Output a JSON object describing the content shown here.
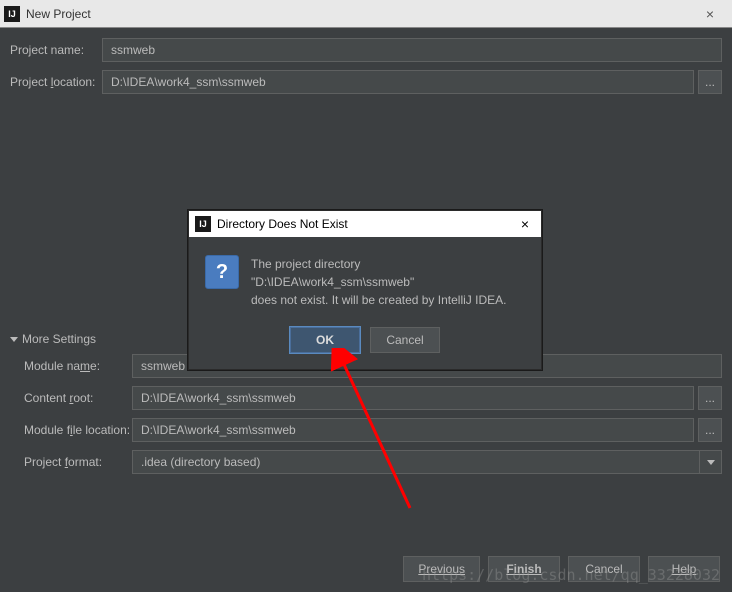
{
  "window": {
    "title": "New Project",
    "close_glyph": "×"
  },
  "fields": {
    "project_name_label": "Project name:",
    "project_name_value": "ssmweb",
    "project_location_label_pre": "Project ",
    "project_location_label_u": "l",
    "project_location_label_post": "ocation:",
    "project_location_value": "D:\\IDEA\\work4_ssm\\ssmweb",
    "browse_glyph": "..."
  },
  "more": {
    "header": "More Settings",
    "module_name_label_pre": "Module na",
    "module_name_label_u": "m",
    "module_name_label_post": "e:",
    "module_name_value": "ssmweb",
    "content_root_label_pre": "Content ",
    "content_root_label_u": "r",
    "content_root_label_post": "oot:",
    "content_root_value": "D:\\IDEA\\work4_ssm\\ssmweb",
    "module_file_label_pre": "Module f",
    "module_file_label_u": "i",
    "module_file_label_post": "le location:",
    "module_file_value": "D:\\IDEA\\work4_ssm\\ssmweb",
    "project_format_label_pre": "Project ",
    "project_format_label_u": "f",
    "project_format_label_post": "ormat:",
    "project_format_value": ".idea (directory based)"
  },
  "buttons": {
    "previous": "Previous",
    "finish": "Finish",
    "cancel": "Cancel",
    "help": "Help"
  },
  "modal": {
    "title": "Directory Does Not Exist",
    "close_glyph": "×",
    "q_glyph": "?",
    "line1": "The project directory",
    "line2": "\"D:\\IDEA\\work4_ssm\\ssmweb\"",
    "line3": "does not exist. It will be created by IntelliJ IDEA.",
    "ok": "OK",
    "cancel": "Cancel"
  },
  "watermark": "https://blog.csdn.net/qq_33228032",
  "app_icon_glyph": "IJ"
}
